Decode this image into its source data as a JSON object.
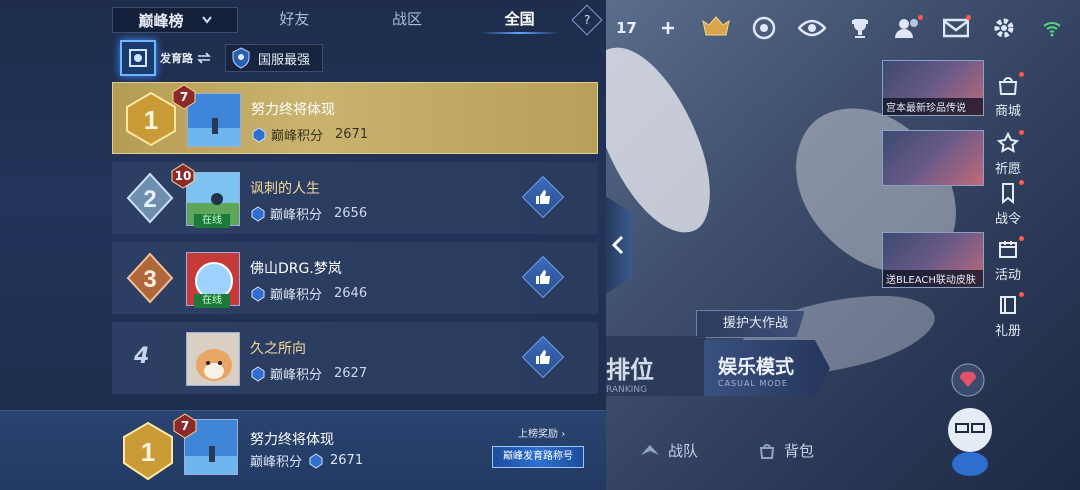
{
  "leaderboard": {
    "dropdown_label": "巅峰榜",
    "tabs": [
      {
        "label": "好友",
        "active": false
      },
      {
        "label": "战区",
        "active": false
      },
      {
        "label": "全国",
        "active": true
      }
    ],
    "help_label": "?",
    "role_filter": "发育路",
    "region_filter": "国服最强",
    "score_label": "巅峰积分",
    "rows": [
      {
        "rank": "1",
        "badge": "7",
        "name": "努力终将体现",
        "score": "2671",
        "online": false,
        "like": false
      },
      {
        "rank": "2",
        "badge": "10",
        "name": "讽刺的人生",
        "score": "2656",
        "online": true,
        "online_label": "在线",
        "like": true
      },
      {
        "rank": "3",
        "badge": "",
        "name": "佛山DRG.梦岚",
        "score": "2646",
        "online": true,
        "online_label": "在线",
        "like": true
      },
      {
        "rank": "4",
        "badge": "",
        "name": "久之所向",
        "score": "2627",
        "online": false,
        "like": true
      }
    ],
    "my_rank": {
      "rank": "1",
      "badge": "7",
      "name": "努力终将体现",
      "score_label": "巅峰积分",
      "score": "2671",
      "reward_link": "上榜奖励",
      "title_badge": "巅峰发育路称号"
    }
  },
  "game_ui": {
    "count": "17",
    "promos": [
      {
        "caption": "宫本最新珍品传说"
      },
      {
        "caption": ""
      },
      {
        "caption": "送BLEACH联动皮肤"
      }
    ],
    "side_menu": [
      "商城",
      "祈愿",
      "战令",
      "活动",
      "礼册"
    ],
    "assist_button": "援护大作战",
    "mode_ranked": "排位",
    "mode_ranked_sub": "RANKING",
    "mode_casual": "娱乐模式",
    "mode_casual_sub": "CASUAL MODE",
    "bottom_nav": [
      "战队",
      "背包"
    ]
  },
  "colors": {
    "gold_row": "#c9b36e",
    "row_bg": "#2c3e63",
    "accent_blue": "#5aa8ff",
    "name_gold": "#f2d89a",
    "online_green": "#1e7a3a"
  }
}
